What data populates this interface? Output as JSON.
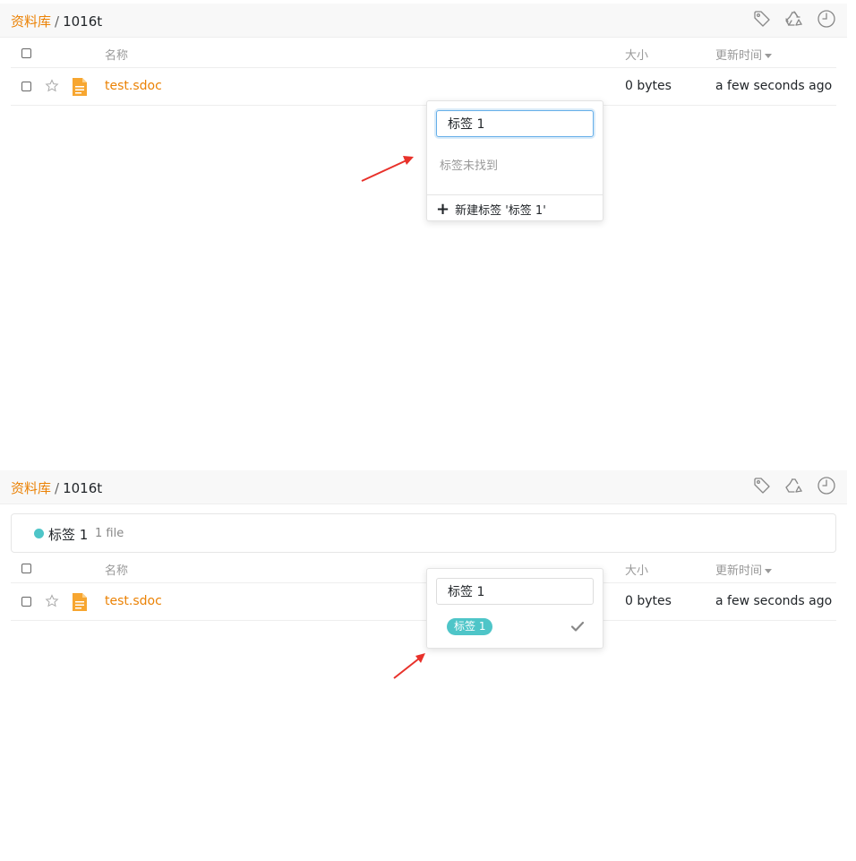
{
  "colors": {
    "accent": "#eb8205",
    "tag": "#4ec5c8",
    "arrow": "#e8312a"
  },
  "panel1": {
    "breadcrumb": {
      "library": "资料库",
      "separator": "/",
      "current": "1016t"
    },
    "toolbar_icons": [
      "tag-icon",
      "recycle-icon",
      "history-icon"
    ],
    "table": {
      "headers": {
        "name": "名称",
        "size": "大小",
        "time": "更新时间"
      },
      "rows": [
        {
          "name": "test.sdoc",
          "size": "0 bytes",
          "time": "a few seconds ago"
        }
      ]
    },
    "popup": {
      "input_value": "标签 1",
      "empty_text": "标签未找到",
      "create_label": "新建标签 '标签 1'"
    }
  },
  "panel2": {
    "breadcrumb": {
      "library": "资料库",
      "separator": "/",
      "current": "1016t"
    },
    "toolbar_icons": [
      "tag-icon",
      "recycle-icon",
      "history-icon"
    ],
    "tag_filter": {
      "name": "标签 1",
      "count": "1 file"
    },
    "table": {
      "headers": {
        "name": "名称",
        "size": "大小",
        "time": "更新时间"
      },
      "rows": [
        {
          "name": "test.sdoc",
          "size": "0 bytes",
          "time": "a few seconds ago"
        }
      ]
    },
    "popup": {
      "input_value": "标签 1",
      "tag_option": "标签 1",
      "selected": true
    }
  }
}
